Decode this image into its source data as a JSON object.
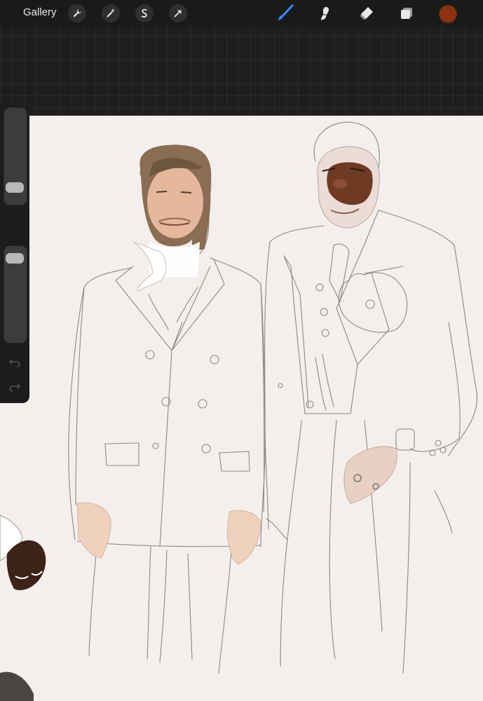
{
  "topbar": {
    "gallery_label": "Gallery",
    "left_tools": [
      "wrench-icon",
      "magic-wand-icon",
      "selection-s-icon",
      "transform-arrow-icon"
    ],
    "right_tools": [
      "brush-icon",
      "smudge-icon",
      "eraser-icon",
      "layers-icon"
    ],
    "active_tool": "brush-icon",
    "active_color": "#8a3310",
    "accent_color": "#2f8cff"
  },
  "sidebar": {
    "brush_size_level": 0.12,
    "opacity_level": 0.06,
    "buttons": [
      "modify-square-button",
      "undo-button",
      "redo-button"
    ]
  },
  "canvas": {
    "background": "#f4efec",
    "content": "drawing-in-progress"
  }
}
